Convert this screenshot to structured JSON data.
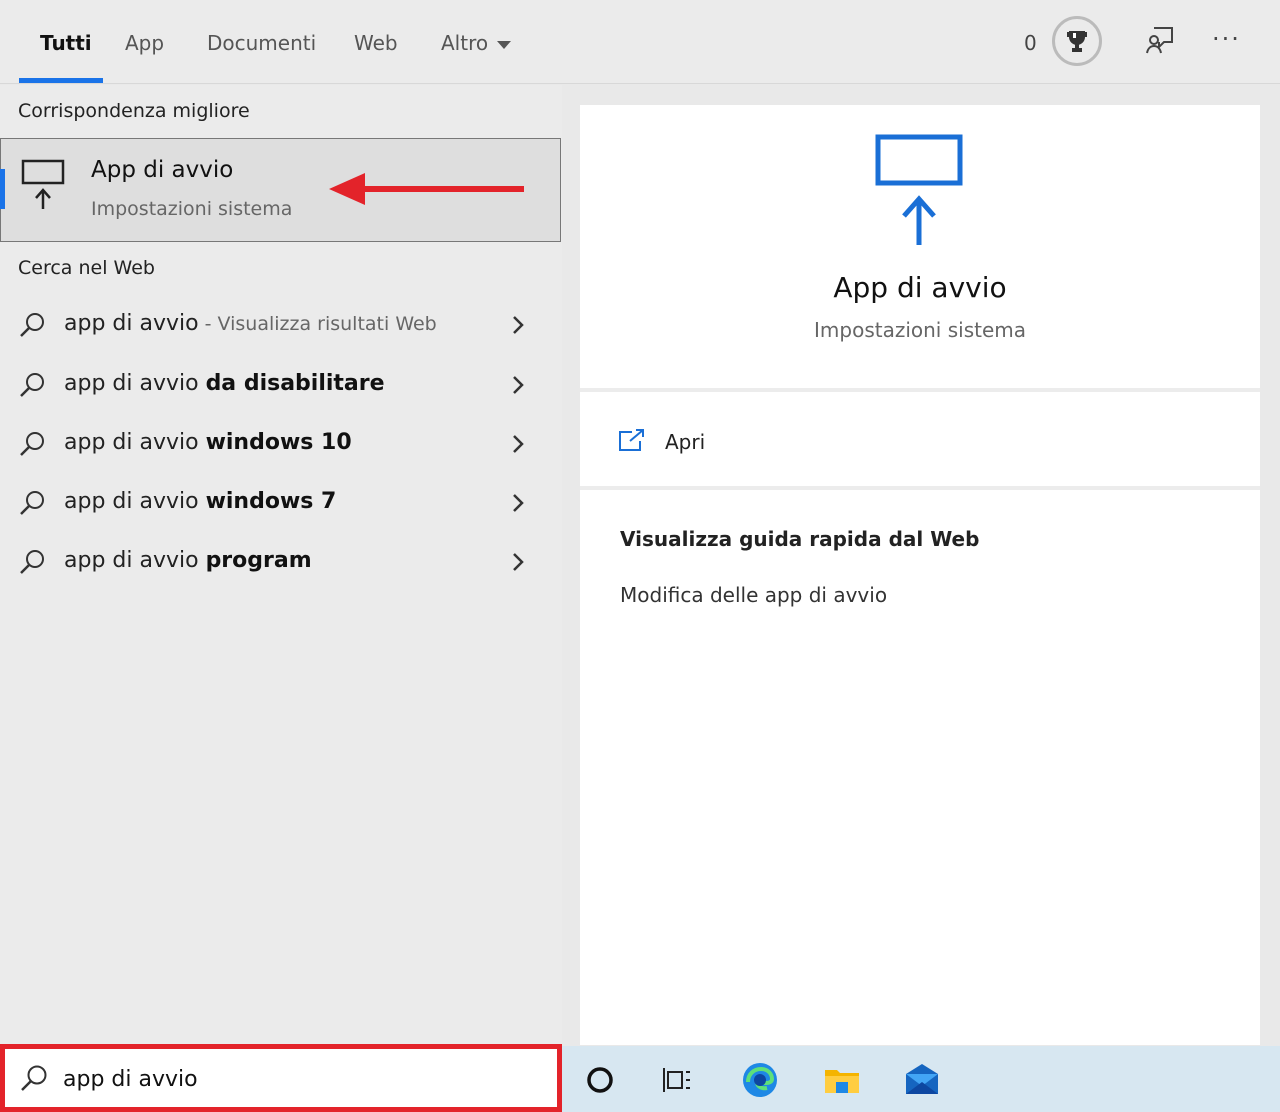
{
  "tabs": [
    {
      "label": "Tutti",
      "active": true
    },
    {
      "label": "App"
    },
    {
      "label": "Documenti"
    },
    {
      "label": "Web"
    },
    {
      "label": "Altro"
    }
  ],
  "header": {
    "points": "0",
    "more": "···"
  },
  "best_match": {
    "section_title": "Corrispondenza migliore",
    "title": "App di avvio",
    "subtitle": "Impostazioni sistema"
  },
  "web_search": {
    "section_title": "Cerca nel Web",
    "items": [
      {
        "prefix": "app di avvio",
        "bold": "",
        "suffix": " - Visualizza risultati Web"
      },
      {
        "prefix": "app di avvio ",
        "bold": "da disabilitare",
        "suffix": ""
      },
      {
        "prefix": "app di avvio ",
        "bold": "windows 10",
        "suffix": ""
      },
      {
        "prefix": "app di avvio ",
        "bold": "windows 7",
        "suffix": ""
      },
      {
        "prefix": "app di avvio ",
        "bold": "program",
        "suffix": ""
      }
    ]
  },
  "detail": {
    "title": "App di avvio",
    "subtitle": "Impostazioni sistema",
    "open_label": "Apri",
    "web_title": "Visualizza guida rapida dal Web",
    "web_link": "Modifica delle app di avvio"
  },
  "search": {
    "value": "app di avvio"
  },
  "colors": {
    "accent": "#1a73e8",
    "highlight": "#e3232a",
    "taskbar": "#d7e7f1"
  }
}
